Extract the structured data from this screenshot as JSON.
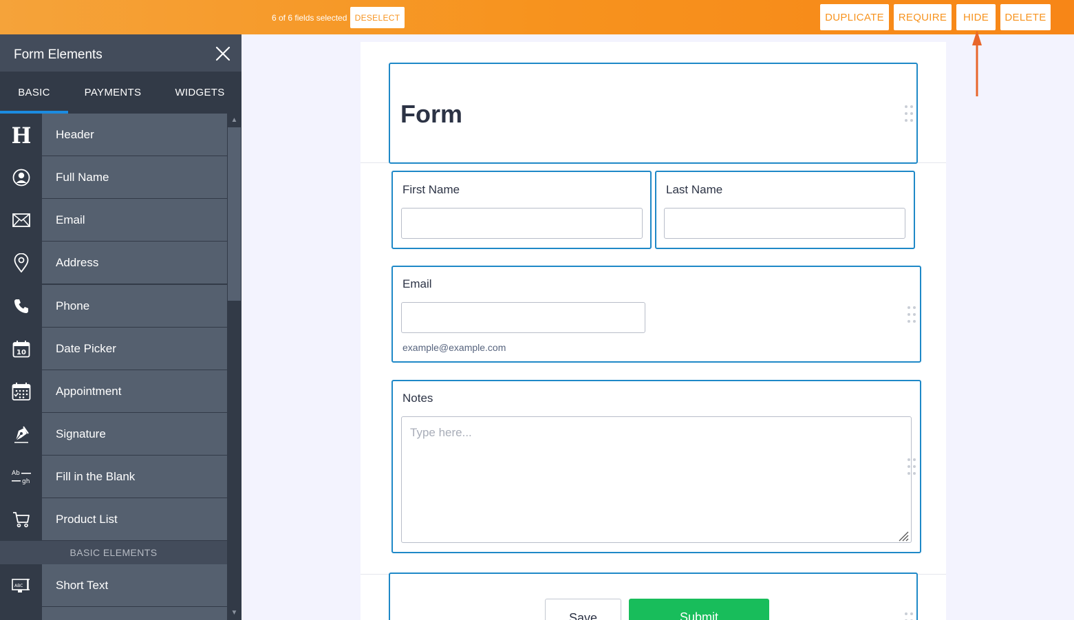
{
  "toolbar": {
    "selection_text": "6 of 6 fields selected",
    "deselect": "DESELECT",
    "duplicate": "DUPLICATE",
    "require": "REQUIRE",
    "hide": "HIDE",
    "delete": "DELETE",
    "accent_color": "#f7931e"
  },
  "sidebar": {
    "title": "Form Elements",
    "tabs": [
      {
        "label": "BASIC",
        "active": true
      },
      {
        "label": "PAYMENTS",
        "active": false
      },
      {
        "label": "WIDGETS",
        "active": false
      }
    ],
    "items": [
      {
        "label": "Header",
        "icon": "header-icon"
      },
      {
        "label": "Full Name",
        "icon": "user-icon"
      },
      {
        "label": "Email",
        "icon": "envelope-icon"
      },
      {
        "label": "Address",
        "icon": "map-pin-icon"
      },
      {
        "label": "Phone",
        "icon": "phone-icon"
      },
      {
        "label": "Date Picker",
        "icon": "calendar-icon"
      },
      {
        "label": "Appointment",
        "icon": "appointment-calendar-icon"
      },
      {
        "label": "Signature",
        "icon": "pen-icon"
      },
      {
        "label": "Fill in the Blank",
        "icon": "fill-blank-icon"
      },
      {
        "label": "Product List",
        "icon": "cart-icon"
      }
    ],
    "section_label": "BASIC ELEMENTS",
    "section_items": [
      {
        "label": "Short Text",
        "icon": "short-text-icon"
      }
    ]
  },
  "form": {
    "title": "Form",
    "first_name_label": "First Name",
    "last_name_label": "Last Name",
    "email_label": "Email",
    "email_sublabel": "example@example.com",
    "notes_label": "Notes",
    "notes_placeholder": "Type here...",
    "save_label": "Save",
    "submit_label": "Submit",
    "selection_color": "#1e88c7",
    "submit_color": "#18bd5b"
  }
}
